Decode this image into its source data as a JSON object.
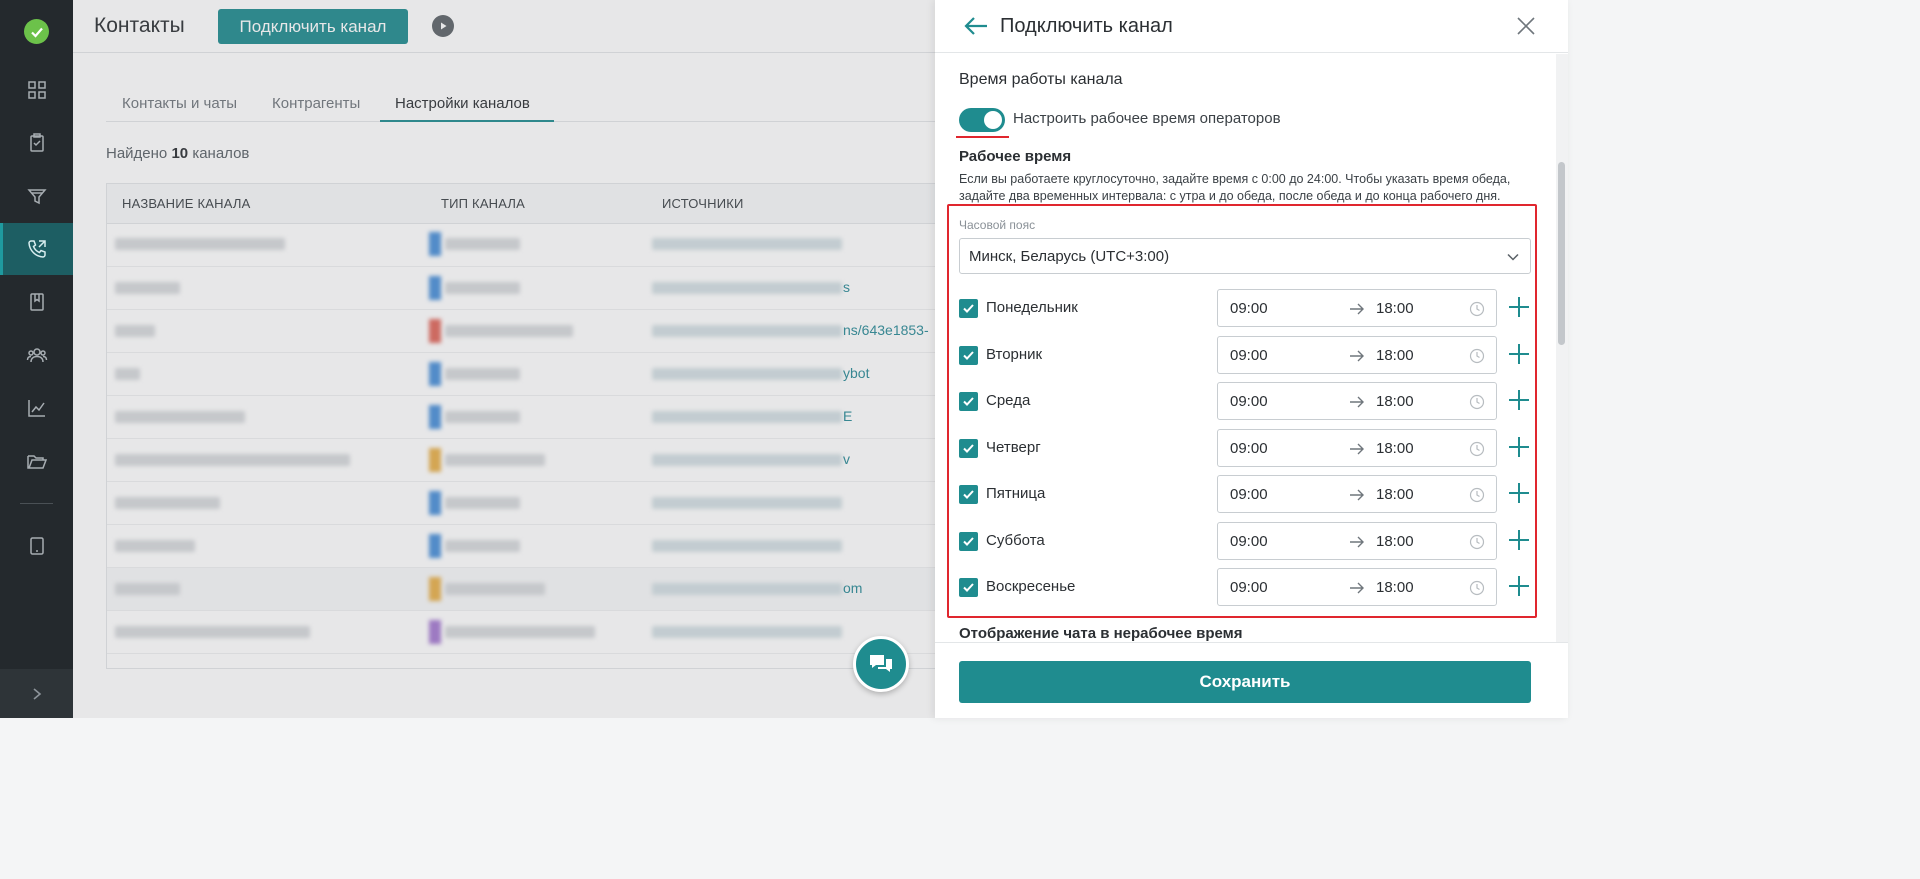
{
  "colors": {
    "accent": "#1f8c8f",
    "sidebar": "#24292d",
    "highlight": "#e0262e"
  },
  "sidebar": {
    "items": [
      {
        "icon": "dashboard-icon"
      },
      {
        "icon": "clipboard-icon"
      },
      {
        "icon": "funnel-icon"
      },
      {
        "icon": "phone-channels-icon",
        "active": true
      },
      {
        "icon": "book-icon"
      },
      {
        "icon": "people-icon"
      },
      {
        "icon": "analytics-icon"
      },
      {
        "icon": "folder-icon"
      },
      {
        "icon": "tablet-icon"
      }
    ],
    "expand_icon": "chevron-right-icon"
  },
  "header": {
    "title": "Контакты",
    "connect_button": "Подключить канал"
  },
  "tabs": [
    {
      "label": "Контакты и чаты"
    },
    {
      "label": "Контрагенты"
    },
    {
      "label": "Настройки каналов",
      "active": true
    }
  ],
  "found": {
    "prefix": "Найдено",
    "count": "10",
    "suffix": "каналов"
  },
  "table": {
    "columns": [
      "НАЗВАНИЕ КАНАЛА",
      "ТИП КАНАЛА",
      "ИСТОЧНИКИ"
    ],
    "visible_source_fragments": [
      "",
      "s",
      "ns/643e1853-",
      "ybot",
      "E",
      "v",
      "",
      "",
      "om",
      ""
    ]
  },
  "panel": {
    "title": "Подключить канал",
    "section_title": "Время работы канала",
    "toggle": {
      "label": "Настроить рабочее время операторов",
      "on": true
    },
    "working_time_title": "Рабочее время",
    "hint": "Если вы работаете круглосуточно, задайте время с 0:00 до 24:00. Чтобы указать время обеда, задайте два временных интервала: с утра и до обеда, после обеда и до конца рабочего дня.",
    "timezone": {
      "label": "Часовой пояс",
      "value": "Минск, Беларусь (UTC+3:00)"
    },
    "days": [
      {
        "name": "Понедельник",
        "checked": true,
        "from": "09:00",
        "to": "18:00"
      },
      {
        "name": "Вторник",
        "checked": true,
        "from": "09:00",
        "to": "18:00"
      },
      {
        "name": "Среда",
        "checked": true,
        "from": "09:00",
        "to": "18:00"
      },
      {
        "name": "Четверг",
        "checked": true,
        "from": "09:00",
        "to": "18:00"
      },
      {
        "name": "Пятница",
        "checked": true,
        "from": "09:00",
        "to": "18:00"
      },
      {
        "name": "Суббота",
        "checked": true,
        "from": "09:00",
        "to": "18:00"
      },
      {
        "name": "Воскресенье",
        "checked": true,
        "from": "09:00",
        "to": "18:00"
      }
    ],
    "after_hours_title": "Отображение чата в нерабочее время",
    "save_button": "Сохранить"
  }
}
